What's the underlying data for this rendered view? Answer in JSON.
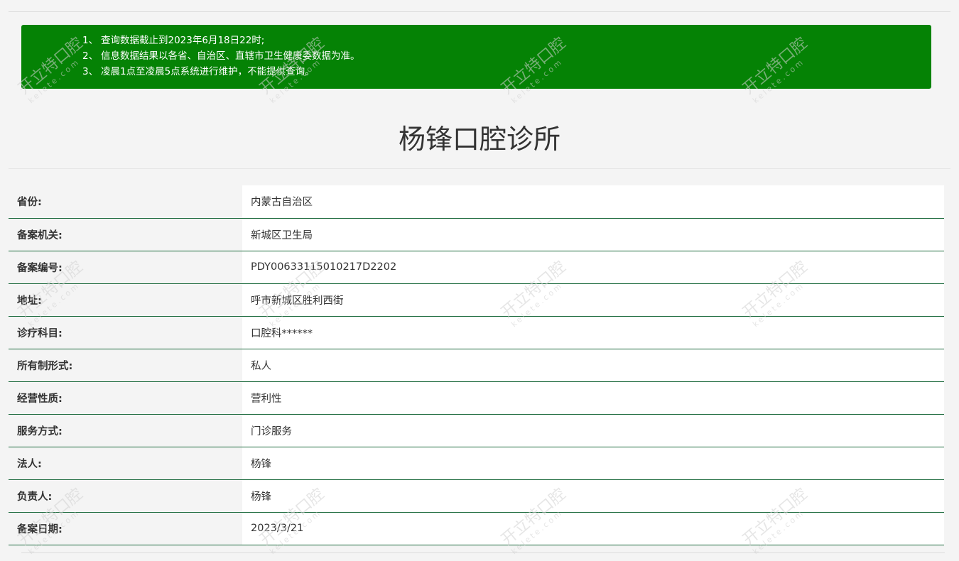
{
  "notice": {
    "lines": [
      {
        "num": "1、",
        "text": "查询数据截止到2023年6月18日22时;"
      },
      {
        "num": "2、",
        "text": "信息数据结果以各省、自治区、直辖市卫生健康委数据为准。"
      },
      {
        "num": "3、",
        "text": "凌晨1点至凌晨5点系统进行维护，不能提供查询。"
      }
    ],
    "background_color": "#058205"
  },
  "title": "杨锋口腔诊所",
  "watermark": {
    "brand": "开立特口腔",
    "site": "kelete.com"
  },
  "rows": [
    {
      "label": "省份:",
      "value": "内蒙古自治区"
    },
    {
      "label": "备案机关:",
      "value": "新城区卫生局"
    },
    {
      "label": "备案编号:",
      "value": "PDY00633115010217D2202"
    },
    {
      "label": "地址:",
      "value": "呼市新城区胜利西街"
    },
    {
      "label": "诊疗科目:",
      "value": "口腔科******"
    },
    {
      "label": "所有制形式:",
      "value": "私人"
    },
    {
      "label": "经营性质:",
      "value": "营利性"
    },
    {
      "label": "服务方式:",
      "value": "门诊服务"
    },
    {
      "label": "法人:",
      "value": "杨锋"
    },
    {
      "label": "负责人:",
      "value": "杨锋"
    },
    {
      "label": "备案日期:",
      "value": "2023/3/21"
    }
  ],
  "colors": {
    "row_border": "#19683a",
    "label_bg": "#f4f4f4",
    "value_bg": "#ffffff"
  }
}
